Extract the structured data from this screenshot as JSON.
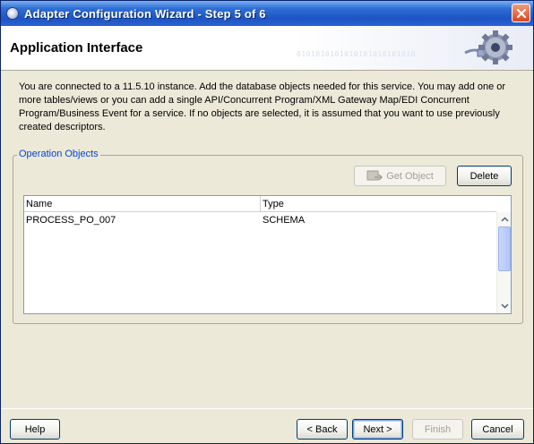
{
  "window": {
    "title": "Adapter Configuration Wizard - Step 5 of 6"
  },
  "header": {
    "heading": "Application Interface",
    "binary_text": "0101010101010101010101010"
  },
  "intro_text": "You are connected to a 11.5.10 instance. Add the database objects needed for this service. You may add one or more tables/views or you can add a single API/Concurrent Program/XML Gateway Map/EDI Concurrent Program/Business Event for a service. If no objects are selected, it is assumed that you want to use previously created descriptors.",
  "operation_objects": {
    "legend": "Operation Objects",
    "get_object_label": "Get Object",
    "delete_label": "Delete",
    "columns": [
      "Name",
      "Type"
    ],
    "rows": [
      {
        "name": "PROCESS_PO_007",
        "type": "SCHEMA"
      }
    ]
  },
  "footer": {
    "help_label": "Help",
    "back_label": "< Back",
    "next_label": "Next >",
    "finish_label": "Finish",
    "cancel_label": "Cancel"
  },
  "icons": {
    "app": "coffee-cup-icon",
    "close": "close-icon",
    "gear": "gear-plug-icon",
    "get_object": "get-object-icon"
  }
}
